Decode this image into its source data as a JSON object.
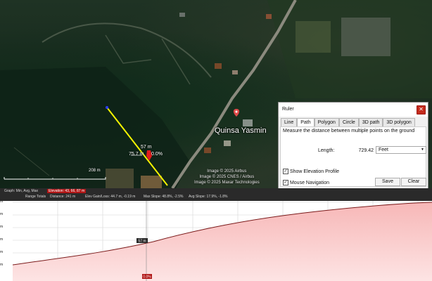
{
  "map": {
    "place_label": "Quinsa Yasmin",
    "scale_label": "208 m",
    "measure": {
      "segment_length": "57 m",
      "left_text": "75.7 m",
      "right_text": "0.0%"
    },
    "credits": [
      "Image © 2025 Airbus",
      "Image © 2025 CNES / Airbus",
      "Image © 2025 Maxar Technologies"
    ]
  },
  "ruler": {
    "title": "Ruler",
    "close_icon": "close-icon",
    "tabs": [
      "Line",
      "Path",
      "Polygon",
      "Circle",
      "3D path",
      "3D polygon"
    ],
    "active_tab": "Path",
    "description": "Measure the distance between multiple points on the ground",
    "length_label": "Length:",
    "length_value": "729.42",
    "unit": "Feet",
    "show_elevation_label": "Show Elevation Profile",
    "mouse_navigation_label": "Mouse Navigation",
    "save_label": "Save",
    "clear_label": "Clear"
  },
  "profile": {
    "header_row1_label": "Graph: Min, Avg, Max",
    "header_row1_value": "Elevation: 43, 66, 87 m",
    "header_row2": {
      "range_totals": "Range Totals",
      "distance": "Distance: 241 m",
      "elev": "Elev Gain/Loss: 44.7 m, -0.19 m",
      "max_slope": "Max Slope: 48.8%, -2.5%",
      "avg_slope": "Avg Slope: 17.9%, -1.8%"
    },
    "y_labels": [
      "m",
      "m",
      "m",
      "m",
      "m",
      "m"
    ],
    "marker_elev": "57 m",
    "marker_slope": "0.0%"
  }
}
